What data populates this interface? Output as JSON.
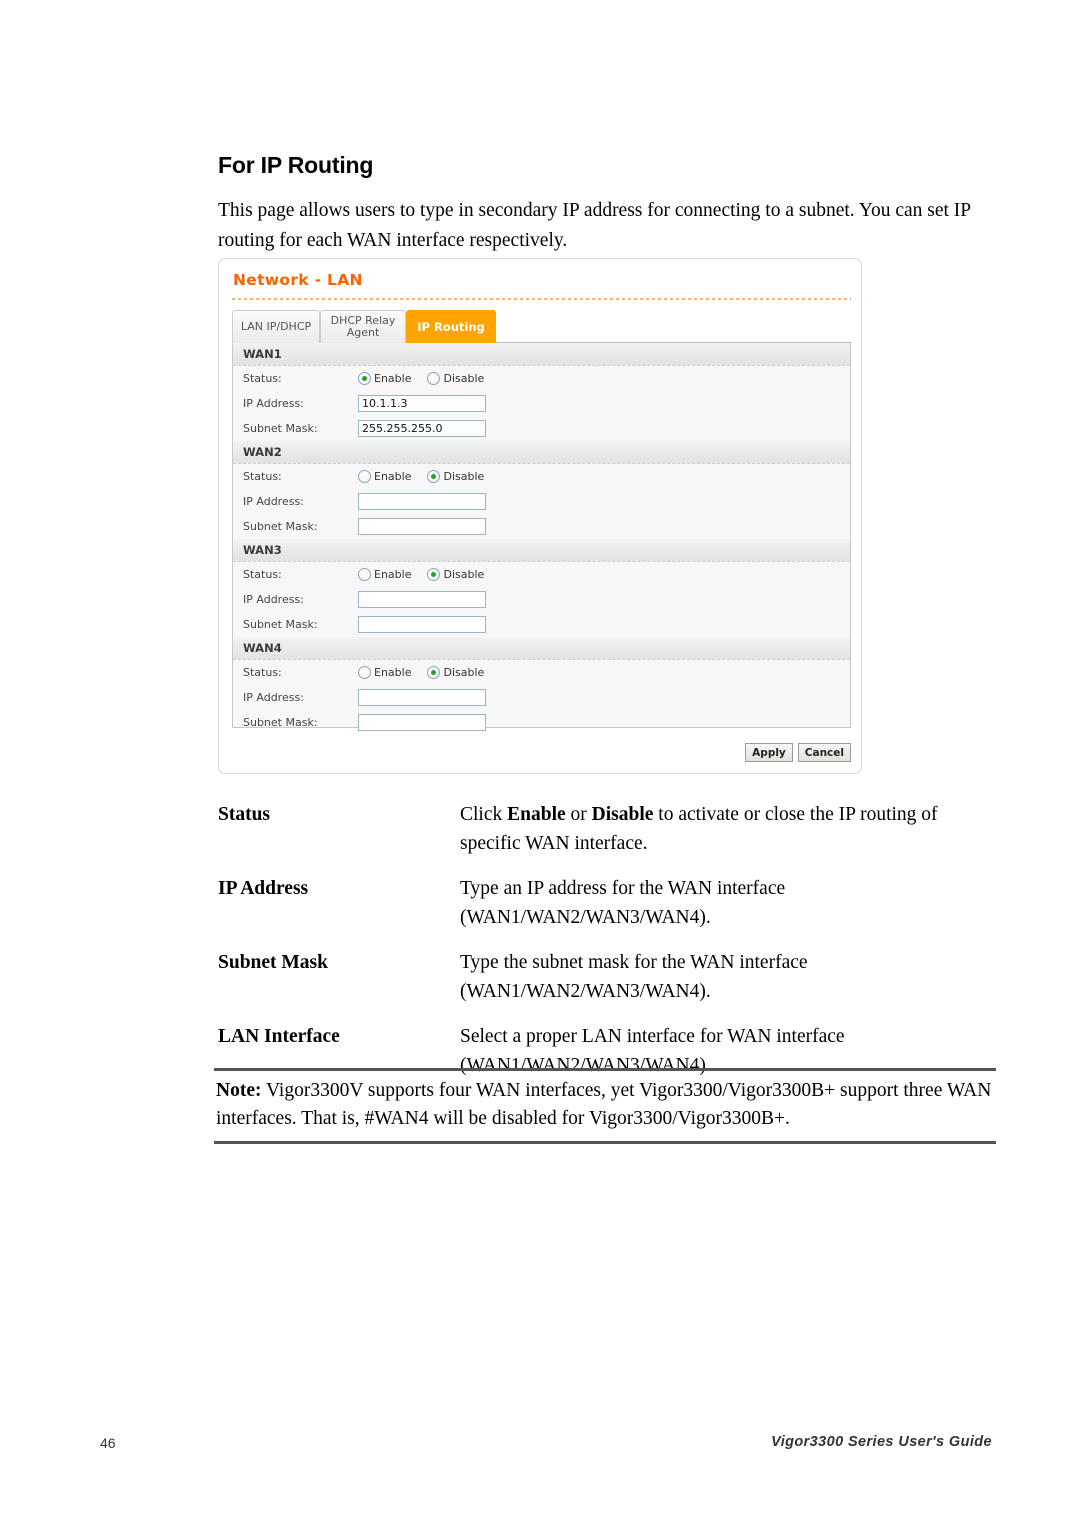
{
  "document": {
    "heading": "For IP Routing",
    "intro": "This page allows users to type in secondary IP address for connecting to a subnet. You can set IP routing for each WAN interface respectively."
  },
  "screenshot": {
    "title": "Network - LAN",
    "tabs": [
      {
        "label": "LAN IP/DHCP",
        "active": false
      },
      {
        "label": "DHCP Relay Agent",
        "active": false
      },
      {
        "label": "IP Routing",
        "active": true
      }
    ],
    "labels": {
      "status": "Status:",
      "ip_address": "IP Address:",
      "subnet_mask": "Subnet Mask:",
      "enable": "Enable",
      "disable": "Disable"
    },
    "sections": [
      {
        "name": "WAN1",
        "status": "Enable",
        "ip_address": "10.1.1.3",
        "subnet_mask": "255.255.255.0"
      },
      {
        "name": "WAN2",
        "status": "Disable",
        "ip_address": "",
        "subnet_mask": ""
      },
      {
        "name": "WAN3",
        "status": "Disable",
        "ip_address": "",
        "subnet_mask": ""
      },
      {
        "name": "WAN4",
        "status": "Disable",
        "ip_address": "",
        "subnet_mask": ""
      }
    ],
    "buttons": {
      "apply": "Apply",
      "cancel": "Cancel"
    },
    "colors": {
      "accent_orange": "#F96400",
      "active_tab": "#FFA400",
      "radio_selected": "#2E9C2E"
    }
  },
  "definitions": [
    {
      "term": "Status",
      "desc_parts": [
        {
          "text": "Click ",
          "bold": false
        },
        {
          "text": "Enable",
          "bold": true
        },
        {
          "text": " or ",
          "bold": false
        },
        {
          "text": "Disable",
          "bold": true
        },
        {
          "text": " to activate or close the IP routing of specific WAN interface.",
          "bold": false
        }
      ]
    },
    {
      "term": "IP Address",
      "desc_parts": [
        {
          "text": "Type an IP address for the WAN interface (WAN1/WAN2/WAN3/WAN4).",
          "bold": false
        }
      ]
    },
    {
      "term": "Subnet Mask",
      "desc_parts": [
        {
          "text": "Type the subnet mask for the WAN interface (WAN1/WAN2/WAN3/WAN4).",
          "bold": false
        }
      ]
    },
    {
      "term": "LAN Interface",
      "desc_parts": [
        {
          "text": "Select a proper LAN interface for WAN interface (WAN1/WAN2/WAN3/WAN4).",
          "bold": false
        }
      ]
    }
  ],
  "note": {
    "label": "Note:",
    "text": " Vigor3300V supports four WAN interfaces, yet Vigor3300/Vigor3300B+ support three WAN interfaces. That is, #WAN4 will be disabled for Vigor3300/Vigor3300B+."
  },
  "footer": {
    "page_number": "46",
    "guide_title": "Vigor3300 Series User's Guide"
  }
}
